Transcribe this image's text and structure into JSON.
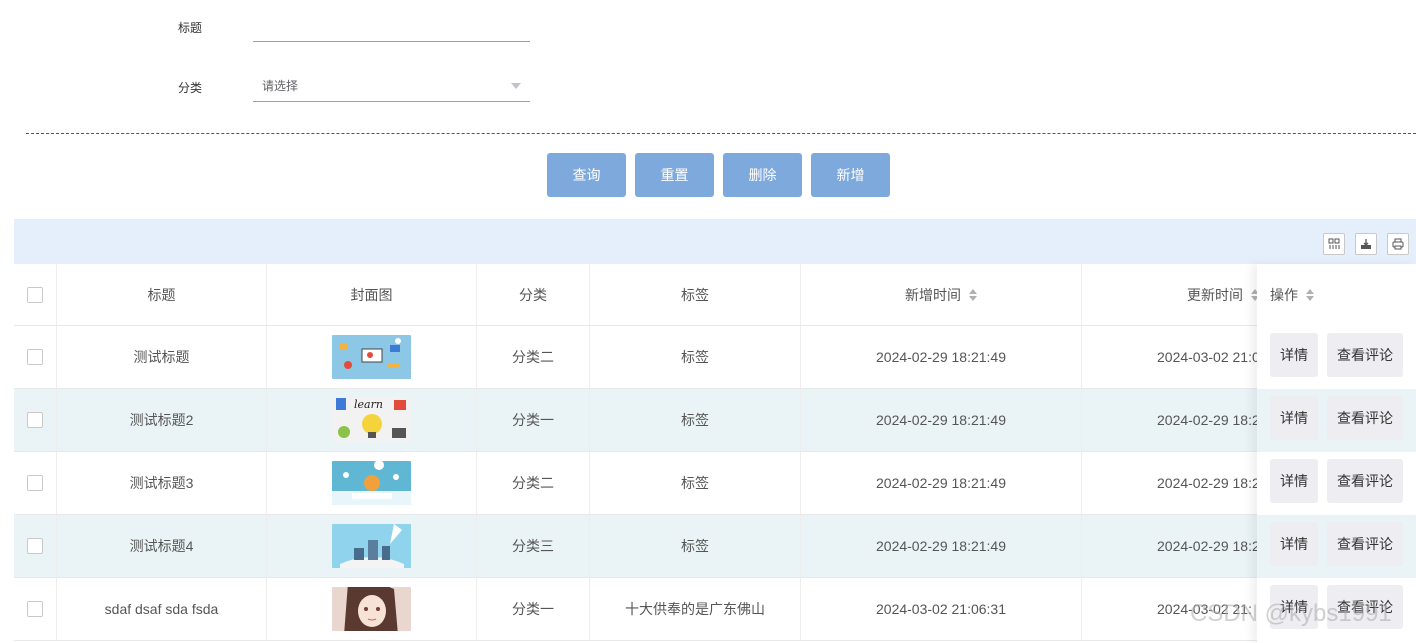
{
  "form": {
    "title_label": "标题",
    "title_value": "",
    "category_label": "分类",
    "category_placeholder": "请选择"
  },
  "actions": {
    "query": "查询",
    "reset": "重置",
    "delete": "删除",
    "add": "新增"
  },
  "toolbar": {
    "icons": [
      "columns-filter-icon",
      "export-icon",
      "print-icon"
    ]
  },
  "table": {
    "columns": [
      "标题",
      "封面图",
      "分类",
      "标签",
      "新增时间",
      "更新时间",
      "操作"
    ],
    "rows": [
      {
        "title": "测试标题",
        "category": "分类二",
        "tag": "标签",
        "created": "2024-02-29 18:21:49",
        "updated": "2024-03-02 21:0",
        "cover": "cover-thumbnail-1"
      },
      {
        "title": "测试标题2",
        "category": "分类一",
        "tag": "标签",
        "created": "2024-02-29 18:21:49",
        "updated": "2024-02-29 18:2",
        "cover": "cover-thumbnail-2"
      },
      {
        "title": "测试标题3",
        "category": "分类二",
        "tag": "标签",
        "created": "2024-02-29 18:21:49",
        "updated": "2024-02-29 18:2",
        "cover": "cover-thumbnail-3"
      },
      {
        "title": "测试标题4",
        "category": "分类三",
        "tag": "标签",
        "created": "2024-02-29 18:21:49",
        "updated": "2024-02-29 18:2",
        "cover": "cover-thumbnail-4"
      },
      {
        "title": "sdaf dsaf sda fsda",
        "category": "分类一",
        "tag": "十大供奉的是广东佛山",
        "created": "2024-03-02 21:06:31",
        "updated": "2024-03-02 21:",
        "cover": "cover-thumbnail-5"
      }
    ],
    "row_actions": {
      "detail": "详情",
      "comments": "查看评论"
    }
  },
  "watermark": "CSDN @kybs1991",
  "colors": {
    "button_bg": "#7ea9dd",
    "toolbar_bg": "#e4effb",
    "alt_row_bg": "#eaf4f7",
    "op_button_bg": "#ededf2"
  }
}
